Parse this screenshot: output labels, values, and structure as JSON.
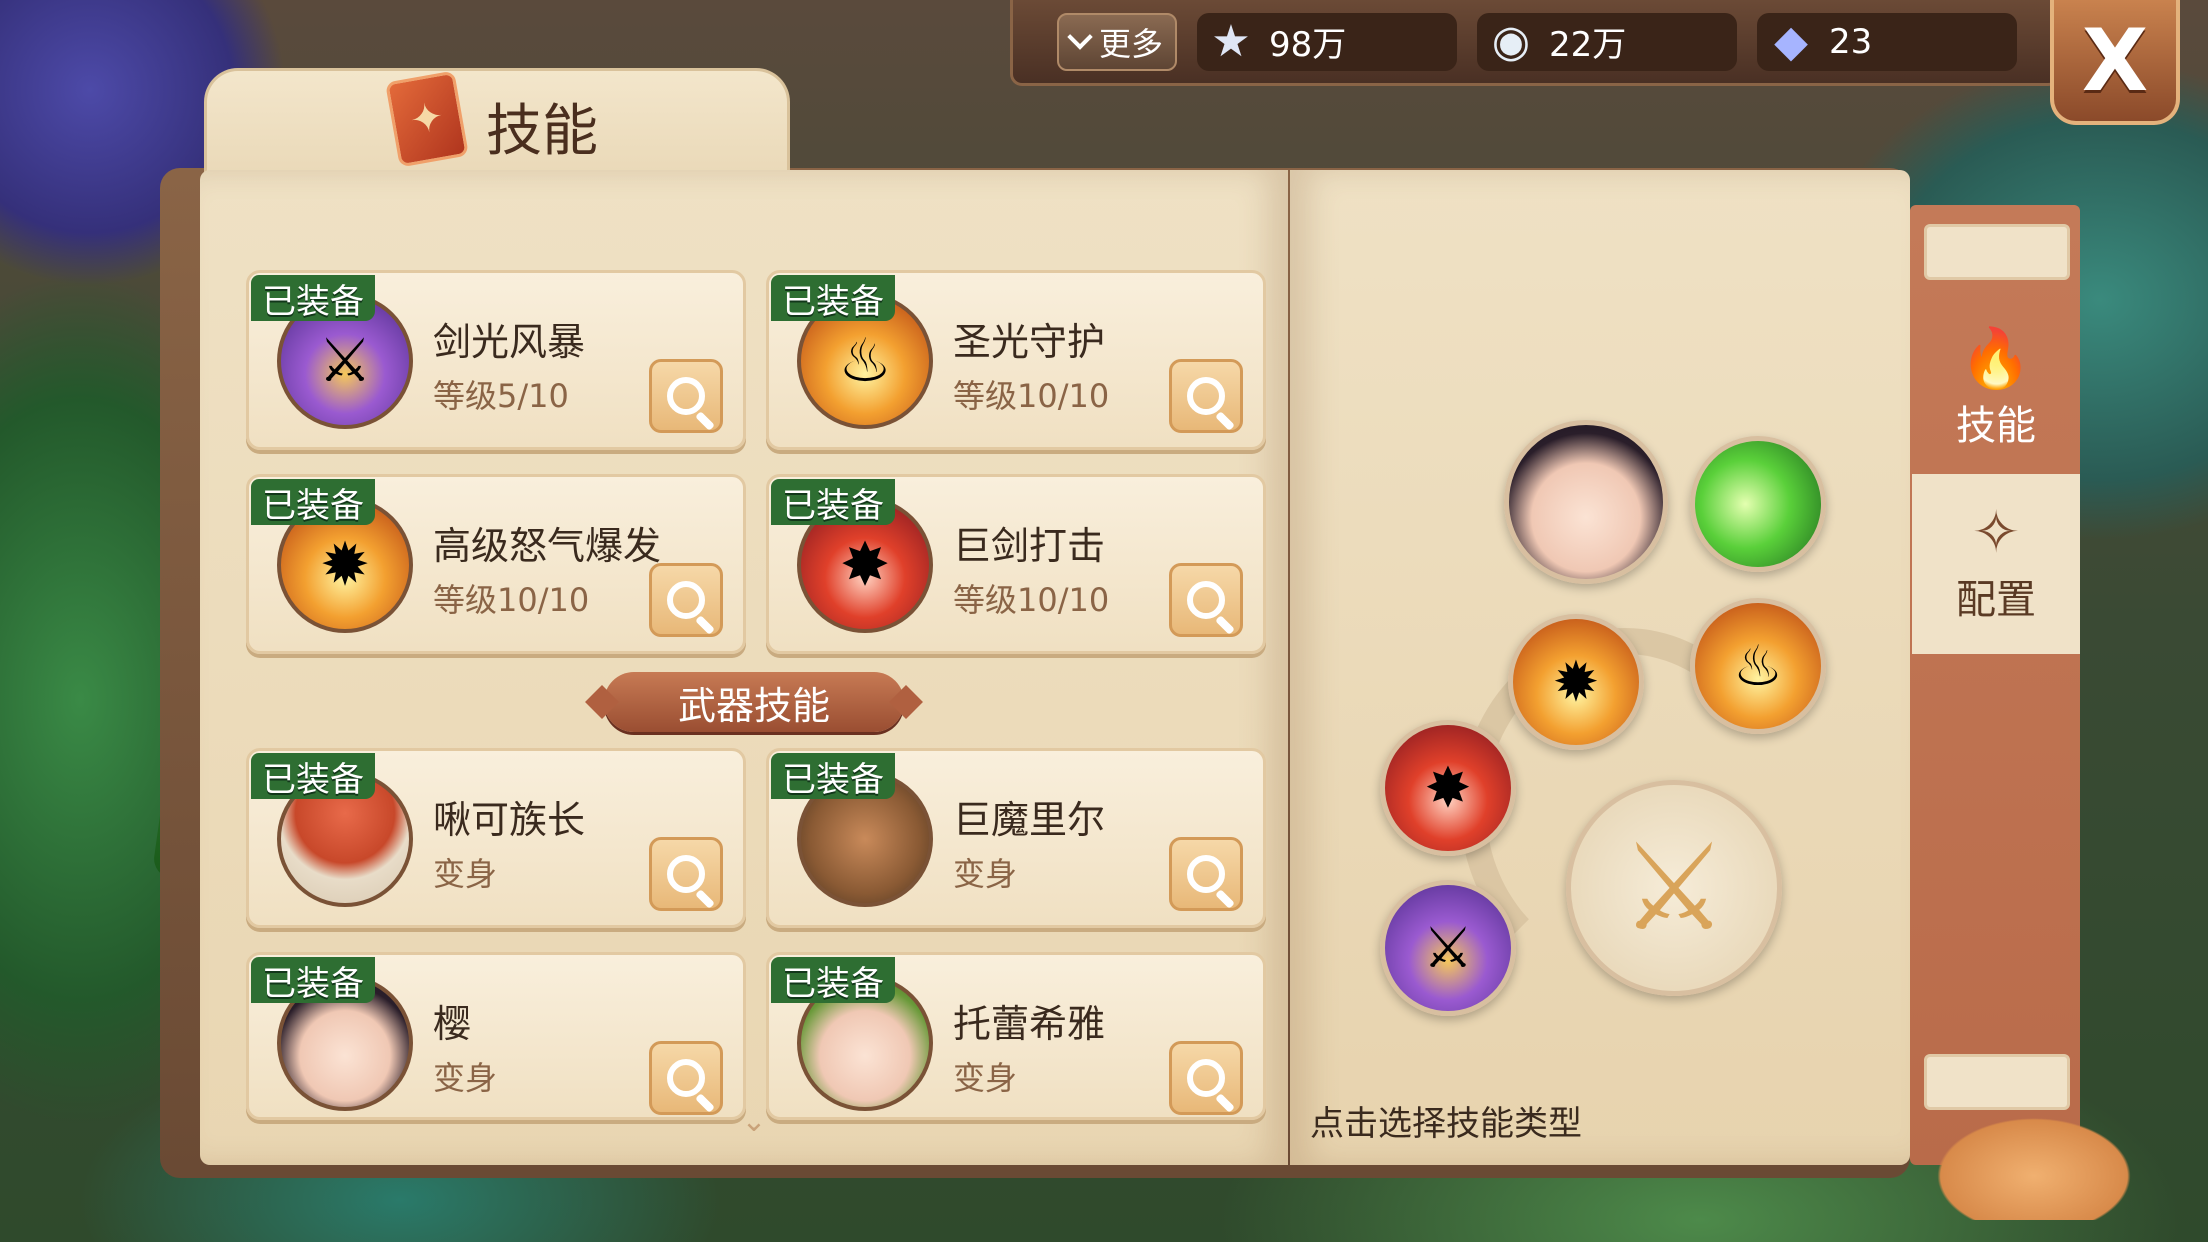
{
  "topbar": {
    "more_label": "更多",
    "resources": [
      {
        "icon": "star-icon",
        "value": "98万"
      },
      {
        "icon": "shell-icon",
        "value": "22万"
      },
      {
        "icon": "crystal-icon",
        "value": "23"
      }
    ],
    "close_label": "X"
  },
  "panel": {
    "title": "技能"
  },
  "skills": [
    {
      "badge": "已装备",
      "name": "剑光风暴",
      "sub": "等级5/10",
      "portrait": "sword-storm-icon"
    },
    {
      "badge": "已装备",
      "name": "圣光守护",
      "sub": "等级10/10",
      "portrait": "holy-guard-icon"
    },
    {
      "badge": "已装备",
      "name": "高级怒气爆发",
      "sub": "等级10/10",
      "portrait": "rage-burst-icon"
    },
    {
      "badge": "已装备",
      "name": "巨剑打击",
      "sub": "等级10/10",
      "portrait": "greatsword-strike-icon"
    }
  ],
  "weapon_section": {
    "title": "武器技能"
  },
  "weapon_skills": [
    {
      "badge": "已装备",
      "name": "啾可族长",
      "sub": "变身",
      "portrait": "mushroom-chief-icon"
    },
    {
      "badge": "已装备",
      "name": "巨魔里尔",
      "sub": "变身",
      "portrait": "ogre-icon"
    },
    {
      "badge": "已装备",
      "name": "樱",
      "sub": "变身",
      "portrait": "sakura-girl-icon"
    },
    {
      "badge": "已装备",
      "name": "托蕾希雅",
      "sub": "变身",
      "portrait": "elf-girl-icon"
    }
  ],
  "config": {
    "hint": "点击选择技能类型"
  },
  "side_tabs": [
    {
      "label": "技能",
      "icon": "flame-icon",
      "active": true
    },
    {
      "label": "配置",
      "icon": "swirl-icon",
      "active": false
    }
  ]
}
